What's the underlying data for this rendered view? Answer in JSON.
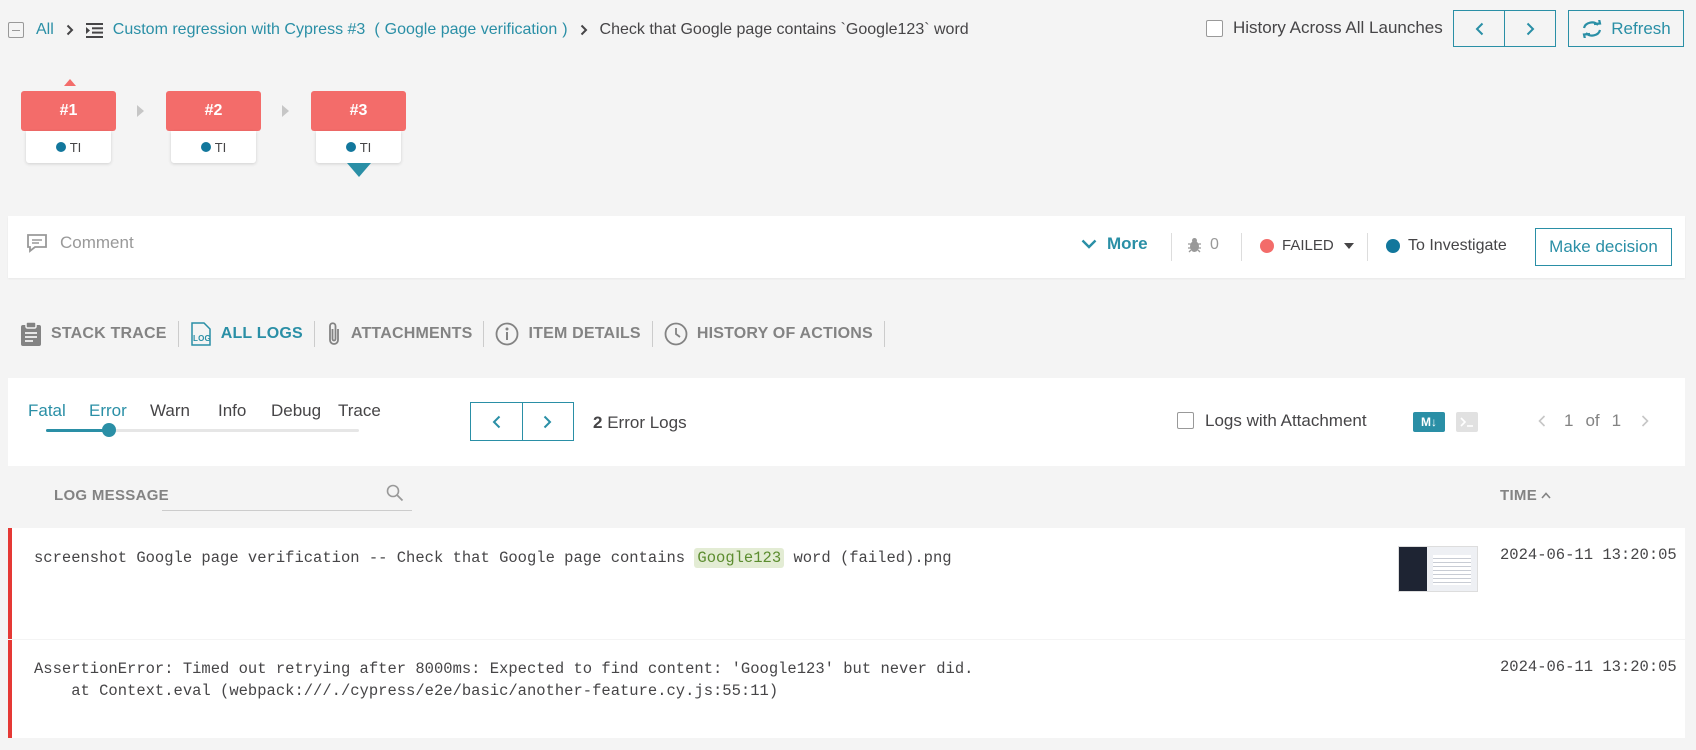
{
  "breadcrumb": {
    "all": "All",
    "launch": "Custom regression with Cypress #3",
    "suite": "Google page verification",
    "paren_open": "(",
    "paren_close": ")",
    "test": "Check that Google page contains `Google123` word"
  },
  "header": {
    "history_label": "History Across All Launches",
    "refresh_label": "Refresh"
  },
  "retries": [
    {
      "label": "#1",
      "defect": "TI"
    },
    {
      "label": "#2",
      "defect": "TI"
    },
    {
      "label": "#3",
      "defect": "TI"
    }
  ],
  "comment_bar": {
    "comment_placeholder": "Comment",
    "more_label": "More",
    "bug_count": "0",
    "status": "FAILED",
    "defect_type": "To Investigate",
    "make_decision_label": "Make decision"
  },
  "tabs": [
    {
      "label": "STACK TRACE",
      "icon": "clipboard-icon"
    },
    {
      "label": "ALL LOGS",
      "icon": "log-icon",
      "active": true
    },
    {
      "label": "ATTACHMENTS",
      "icon": "paperclip-icon"
    },
    {
      "label": "ITEM DETAILS",
      "icon": "info-icon"
    },
    {
      "label": "HISTORY OF ACTIONS",
      "icon": "clock-icon"
    }
  ],
  "log_levels": [
    "Fatal",
    "Error",
    "Warn",
    "Info",
    "Debug",
    "Trace"
  ],
  "log_level_selected": "Error",
  "error_logs": {
    "count": "2",
    "label": "Error Logs"
  },
  "logs_with_attachment_label": "Logs with Attachment",
  "markdown_label": "M↓",
  "pagination": {
    "current": "1",
    "of_label": "of",
    "total": "1"
  },
  "table": {
    "col_message": "LOG MESSAGE",
    "col_time": "TIME",
    "rows": [
      {
        "msg_before": "screenshot Google page verification -- Check that Google page contains ",
        "msg_highlight": "Google123",
        "msg_after": " word (failed).png",
        "time": "2024-06-11 13:20:05"
      },
      {
        "msg_line1": "AssertionError: Timed out retrying after 8000ms: Expected to find content: 'Google123' but never did.",
        "msg_line2": "    at Context.eval (webpack:///./cypress/e2e/basic/another-feature.cy.js:55:11)",
        "time": "2024-06-11 13:20:05"
      }
    ]
  },
  "colors": {
    "accent": "#2a8fa6",
    "failed": "#f36c6a",
    "to_investigate": "#12779c",
    "error_bar": "#e53935"
  }
}
